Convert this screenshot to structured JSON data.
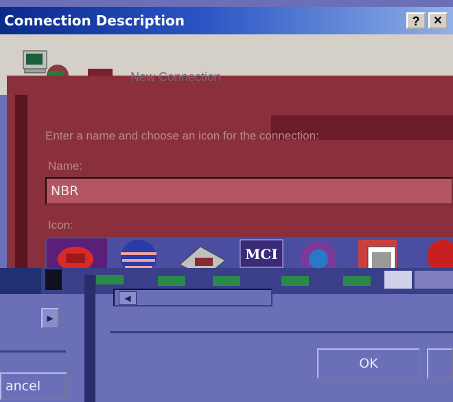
{
  "window": {
    "title": "Connection Description",
    "help_label": "?",
    "close_label": "✕"
  },
  "header": {
    "connection_label": "New Connection",
    "icon": "computer-icon"
  },
  "form": {
    "prompt": "Enter a name and choose an icon for the connection:",
    "name_label": "Name:",
    "name_value": "NBR",
    "icon_label": "Icon:",
    "icons": [
      "phone-icon",
      "globe-icon",
      "fax-icon",
      "mci-icon",
      "world-icon",
      "book-icon",
      "red-icon"
    ]
  },
  "buttons": {
    "ok_label": "OK",
    "cancel_label": "ancel"
  },
  "colors": {
    "title_bar": "#0a2a8c",
    "dialog_face": "#d4d0c8",
    "maroon_overlay": "#8a2f3c",
    "blue_overlay": "#6b6fb8"
  }
}
